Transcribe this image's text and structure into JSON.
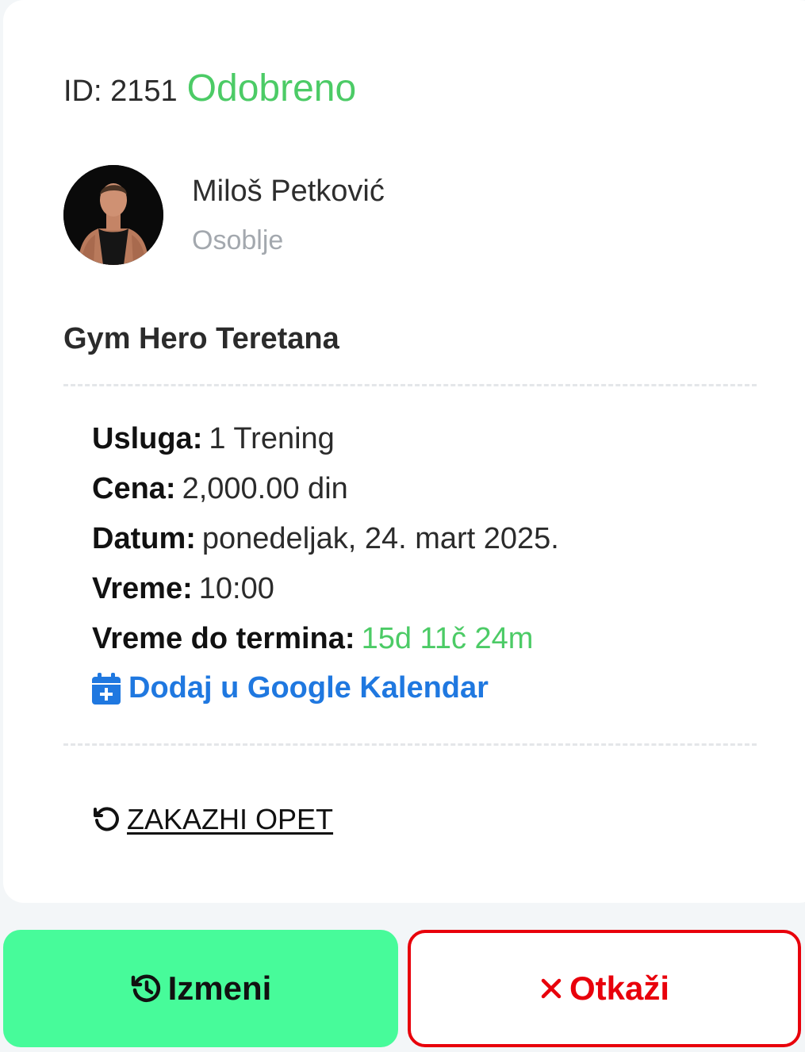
{
  "booking": {
    "id_label": "ID: 2151",
    "status": "Odobreno",
    "status_color": "#4ccb66"
  },
  "staff": {
    "name": "Miloš Petković",
    "role": "Osoblje",
    "avatar_icon": "trainer-photo"
  },
  "gym": {
    "name": "Gym Hero Teretana"
  },
  "details": {
    "service_label": "Usluga:",
    "service_value": "1 Trening",
    "price_label": "Cena:",
    "price_value": "2,000.00 din",
    "date_label": "Datum:",
    "date_value": "ponedeljak, 24. mart 2025.",
    "time_label": "Vreme:",
    "time_value": "10:00",
    "countdown_label": "Vreme do termina:",
    "countdown_value": "15d 11č 24m"
  },
  "calendar_link": {
    "label": "Dodaj u Google Kalendar",
    "icon": "calendar-plus-icon",
    "color": "#1f78e0"
  },
  "rebook": {
    "label": "ZAKAZHI OPET",
    "icon": "rotate-left-icon"
  },
  "actions": {
    "edit_label": "Izmeni",
    "edit_icon": "history-icon",
    "edit_color": "#47fb9a",
    "cancel_label": "Otkaži",
    "cancel_icon": "close-icon",
    "cancel_color": "#e8000b"
  }
}
